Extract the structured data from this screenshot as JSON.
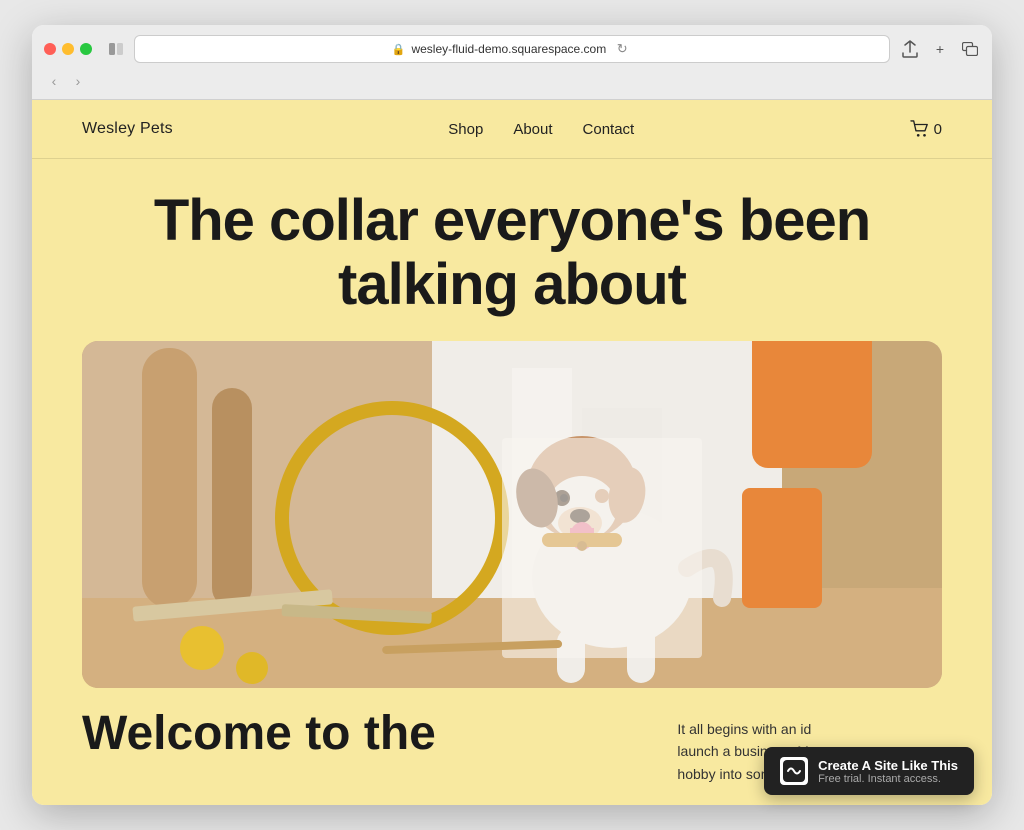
{
  "browser": {
    "url": "wesley-fluid-demo.squarespace.com",
    "reload_icon": "↻",
    "back_icon": "‹",
    "forward_icon": "›",
    "share_icon": "⬆",
    "add_tab_icon": "+",
    "windows_icon": "⧉"
  },
  "site": {
    "logo": "Wesley Pets",
    "nav": {
      "shop": "Shop",
      "about": "About",
      "contact": "Contact"
    },
    "cart_count": "0",
    "hero_title_line1": "The collar everyone's been",
    "hero_title_line2": "talking about",
    "bottom_heading_line1": "Welcome to the",
    "bottom_text_line1": "It all begins with an id",
    "bottom_text_line2": "launch a business. Ma",
    "bottom_text_line3": "hobby into something more. Or maybe you"
  },
  "squarespace": {
    "main_text": "Create A Site Like This",
    "sub_text": "Free trial. Instant access.",
    "logo_char": "◈"
  }
}
